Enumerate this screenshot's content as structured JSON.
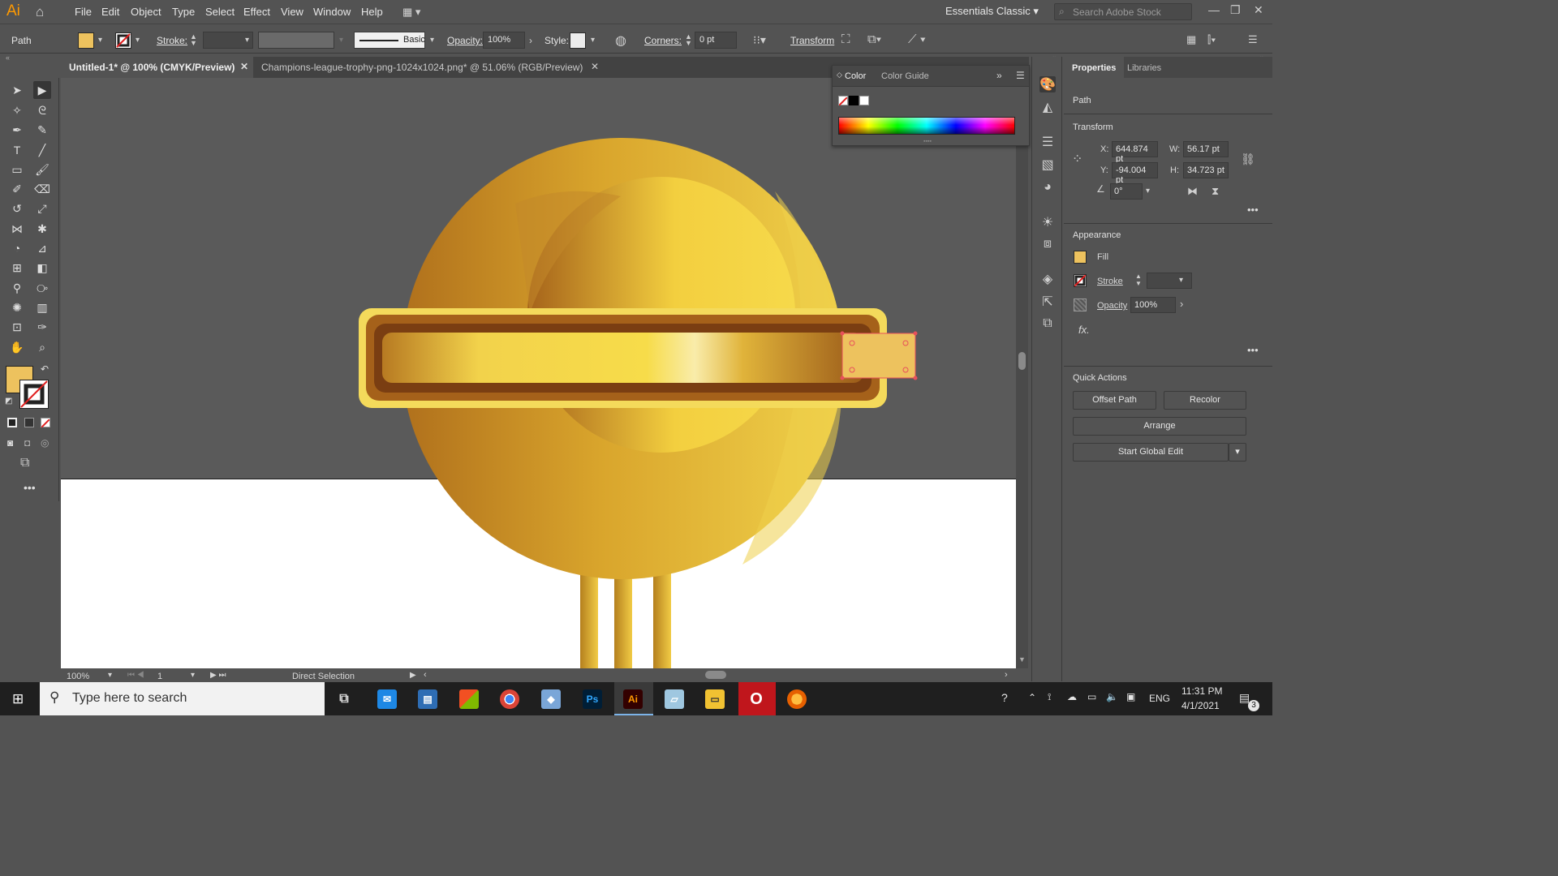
{
  "app": {
    "logo": "Ai"
  },
  "menu": [
    "File",
    "Edit",
    "Object",
    "Type",
    "Select",
    "Effect",
    "View",
    "Window",
    "Help"
  ],
  "workspace": {
    "label": "Essentials Classic",
    "search_placeholder": "Search Adobe Stock"
  },
  "control_bar": {
    "object_type": "Path",
    "stroke_label": "Stroke:",
    "brush_label": "Basic",
    "opacity_label": "Opacity:",
    "opacity_value": "100%",
    "style_label": "Style:",
    "corners_label": "Corners:",
    "corners_value": "0 pt",
    "transform_label": "Transform"
  },
  "tabs": [
    {
      "label": "Untitled-1* @ 100% (CMYK/Preview)"
    },
    {
      "label": "Champions-league-trophy-png-1024x1024.png* @ 51.06% (RGB/Preview)"
    }
  ],
  "color_panel": {
    "tabs": [
      "Color",
      "Color Guide"
    ]
  },
  "properties": {
    "tabs": [
      "Properties",
      "Libraries"
    ],
    "selection_type": "Path",
    "transform": {
      "title": "Transform",
      "x_label": "X:",
      "x_value": "644.874 pt",
      "y_label": "Y:",
      "y_value": "-94.004 pt",
      "w_label": "W:",
      "w_value": "56.17 pt",
      "h_label": "H:",
      "h_value": "34.723 pt",
      "angle_value": "0°"
    },
    "appearance": {
      "title": "Appearance",
      "fill_label": "Fill",
      "stroke_label": "Stroke",
      "opacity_label": "Opacity",
      "opacity_value": "100%",
      "fx_label": "fx."
    },
    "quick_actions": {
      "title": "Quick Actions",
      "offset_path": "Offset Path",
      "recolor": "Recolor",
      "arrange": "Arrange",
      "start_global_edit": "Start Global Edit"
    }
  },
  "status_bar": {
    "zoom": "100%",
    "artboard_number": "1",
    "tool_name": "Direct Selection"
  },
  "colors": {
    "fill": "#edc25e",
    "accent": "#ff9a00",
    "selection": "#e8505b"
  },
  "taskbar": {
    "search_placeholder": "Type here to search",
    "language": "ENG",
    "time": "11:31 PM",
    "date": "4/1/2021",
    "notification_count": "3"
  }
}
